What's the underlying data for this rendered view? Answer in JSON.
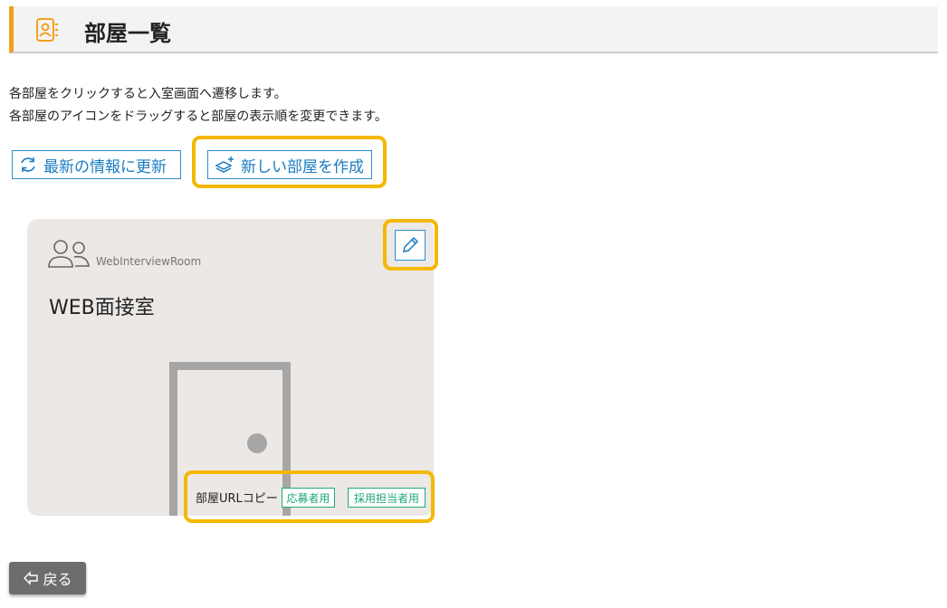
{
  "header": {
    "title": "部屋一覧",
    "icon": "contact-book-icon"
  },
  "description": {
    "line1": "各部屋をクリックすると入室画面へ遷移します。",
    "line2": "各部屋のアイコンをドラッグすると部屋の表示順を変更できます。"
  },
  "toolbar": {
    "refresh_label": "最新の情報に更新",
    "refresh_icon": "refresh-icon",
    "create_label": "新しい部屋を作成",
    "create_icon": "stack-plus-icon"
  },
  "rooms": [
    {
      "subtitle": "WebInterviewRoom",
      "title": "WEB面接室",
      "icon": "users-icon",
      "edit_icon": "pencil-icon",
      "url_copy_label": "部屋URLコピー",
      "tags": [
        "応募者用",
        "採用担当者用"
      ]
    }
  ],
  "back": {
    "label": "戻る",
    "icon": "arrow-left-icon"
  },
  "colors": {
    "accent": "#f0a020",
    "link_blue": "#1a7cc2",
    "highlight": "#f5b800",
    "tag_green": "#20a874",
    "card_bg": "#ebe8e6"
  }
}
